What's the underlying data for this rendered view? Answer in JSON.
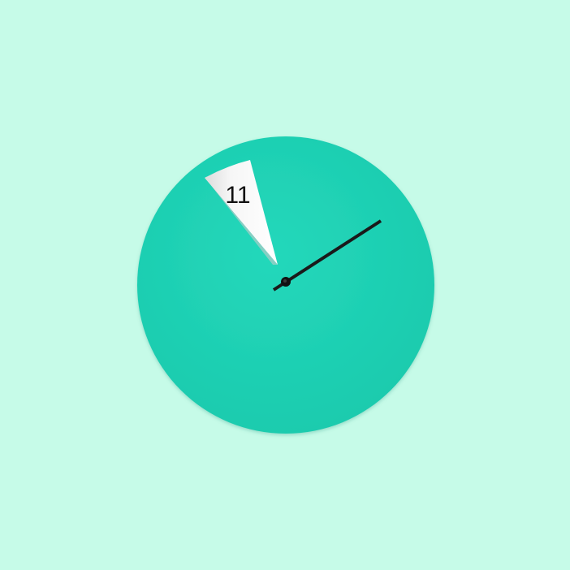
{
  "scene": {
    "description_free": true,
    "background_color": "#c6fbe8"
  },
  "clock": {
    "face_color": "#1fd3b6",
    "window_color": "#f4f4f4",
    "window_shadow_color": "#d9d9d9",
    "hand_color": "#1a1a1a",
    "hour_display": "11",
    "minute_hand_points_to_minute": 10
  }
}
